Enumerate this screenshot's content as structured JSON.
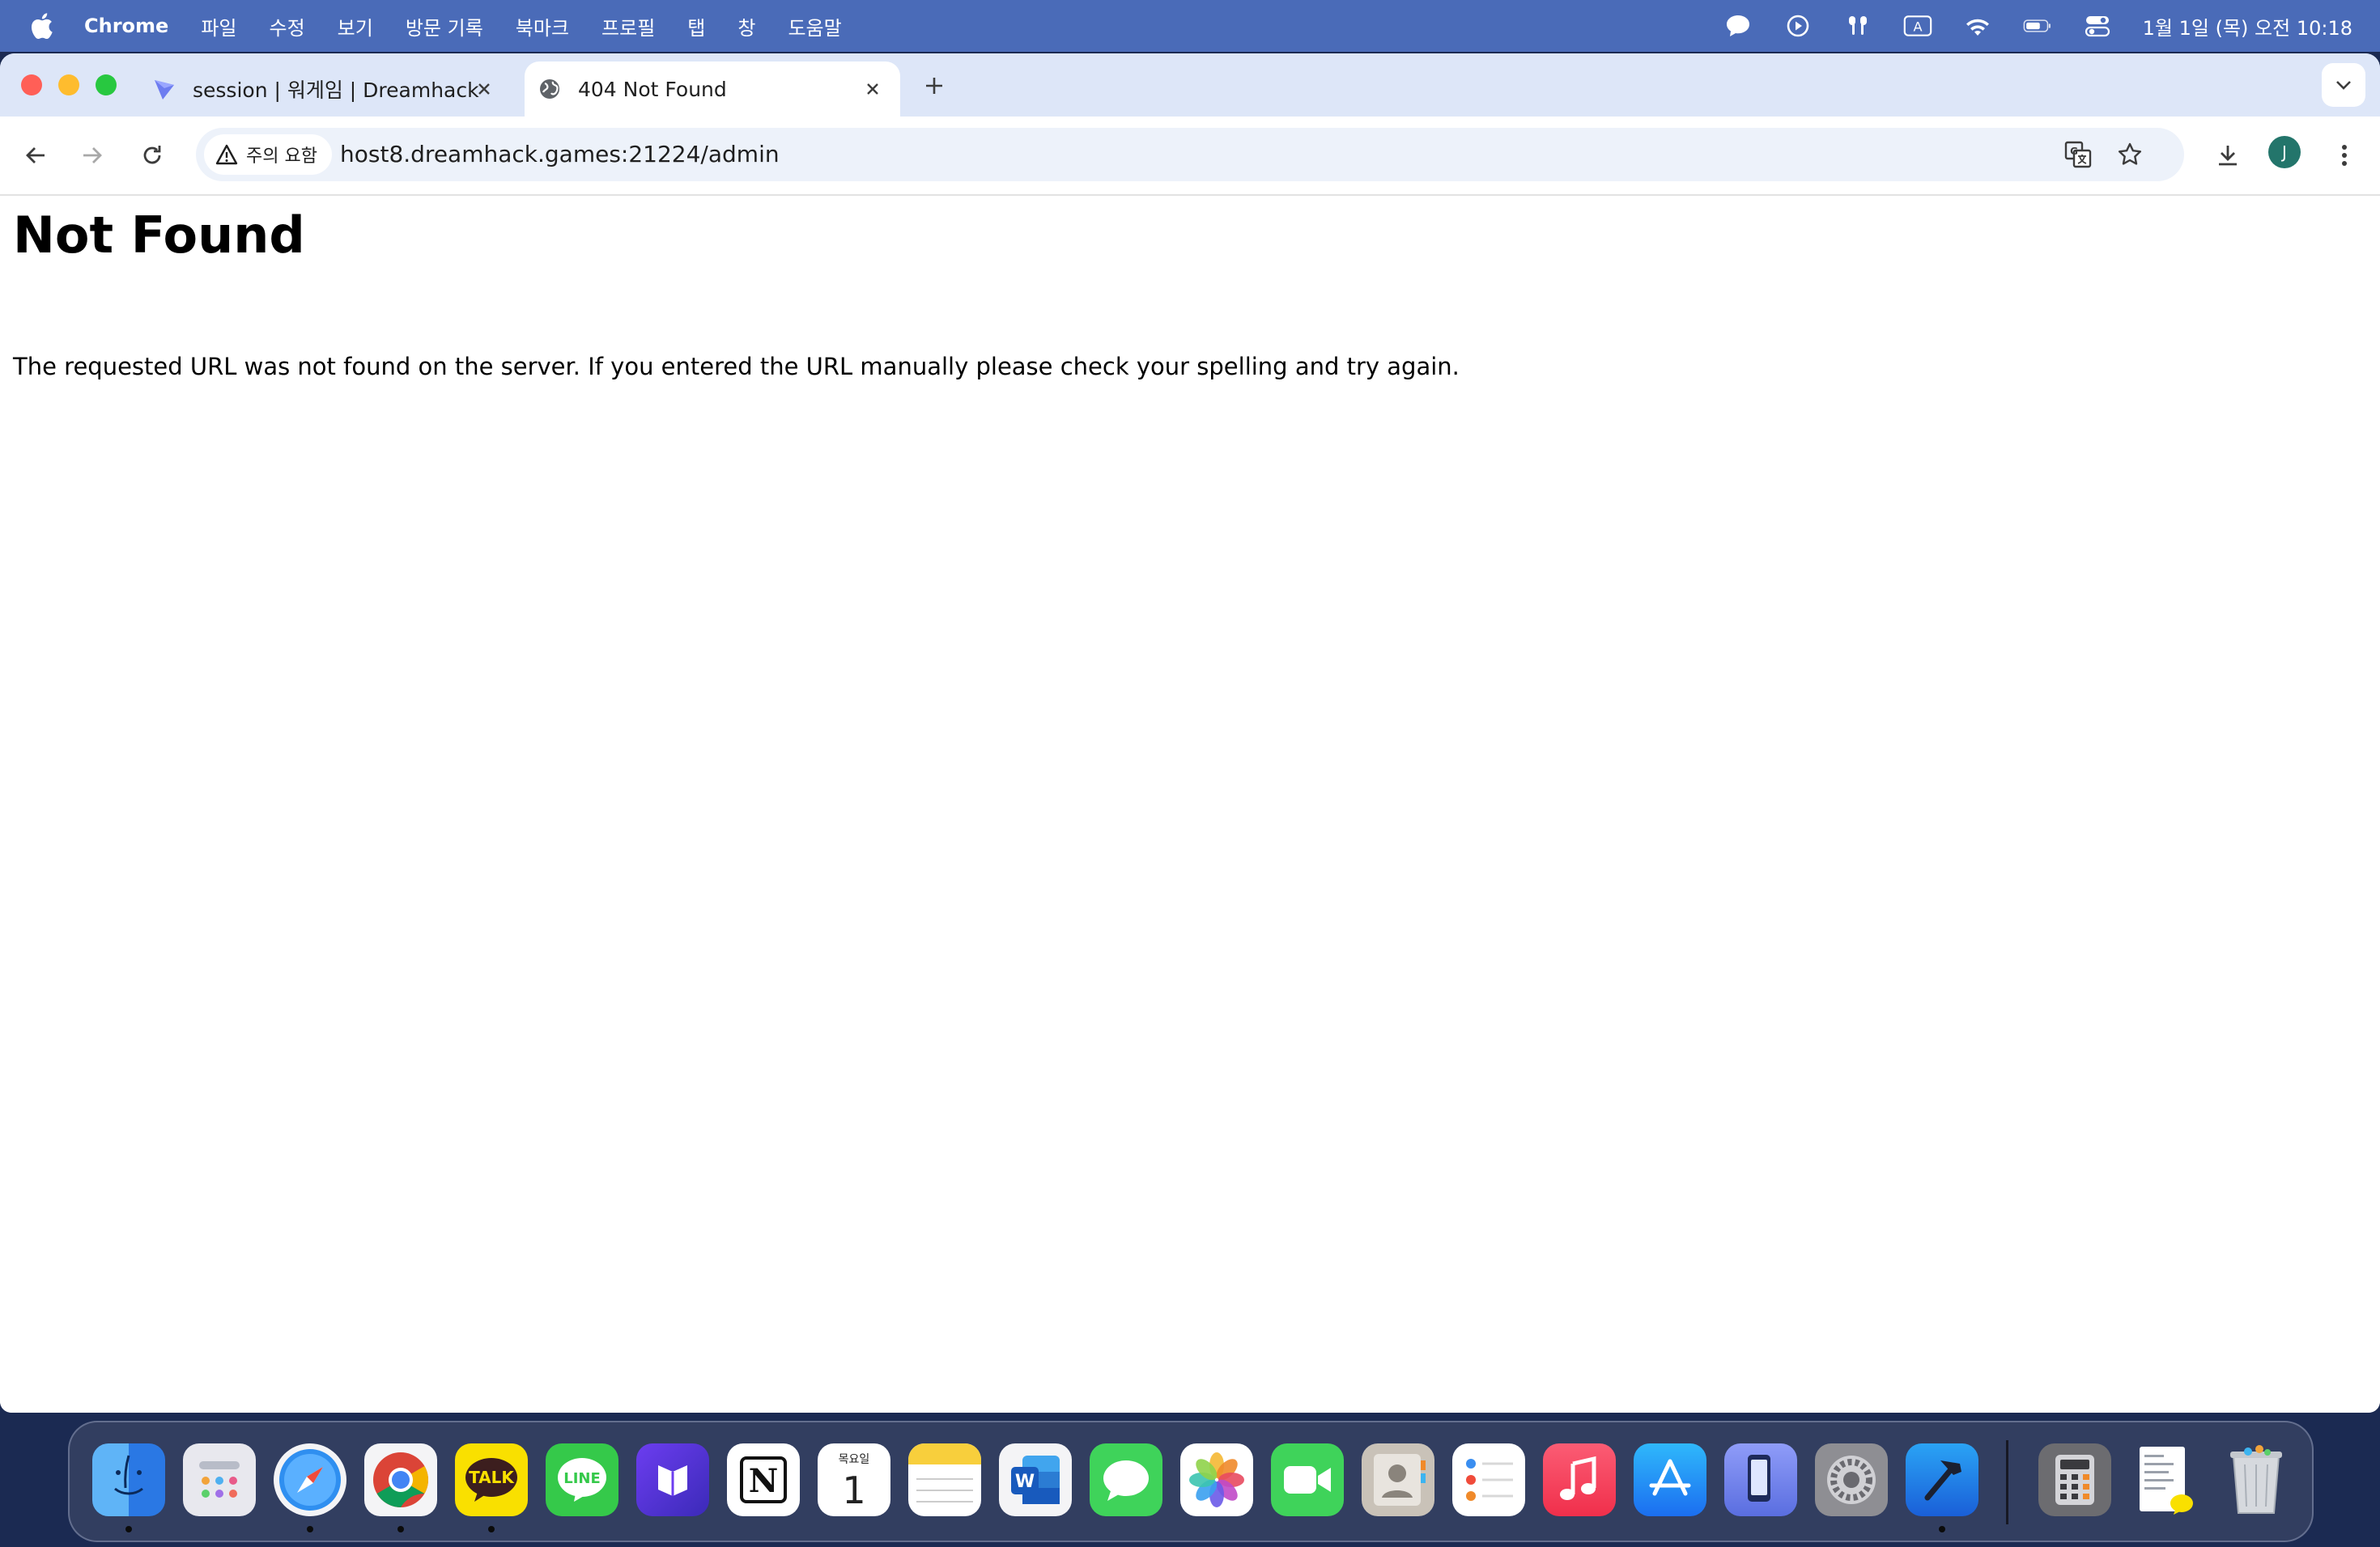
{
  "menubar": {
    "app_name": "Chrome",
    "menus": [
      "파일",
      "수정",
      "보기",
      "방문 기록",
      "북마크",
      "프로필",
      "탭",
      "창",
      "도움말"
    ],
    "clock": "1월 1일 (목) 오전 10:18",
    "status_icons": [
      "speech-bubble-icon",
      "play-circle-icon",
      "airpods-icon",
      "input-source-icon",
      "wifi-icon",
      "battery-icon",
      "control-center-icon"
    ],
    "input_source_letter": "A"
  },
  "tabs": [
    {
      "title": "session | 워게임 | Dreamhack",
      "favicon": "dreamhack-icon",
      "active": false
    },
    {
      "title": "404 Not Found",
      "favicon": "globe-icon",
      "active": true
    }
  ],
  "toolbar": {
    "security_chip": "주의 요함",
    "url": "host8.dreamhack.games:21224/admin",
    "profile_initial": "J"
  },
  "page": {
    "title": "Not Found",
    "message": "The requested URL was not found on the server. If you entered the URL manually please check your spelling and try again."
  },
  "dock": {
    "apps": [
      "Finder",
      "Launchpad",
      "Safari",
      "Chrome",
      "KakaoTalk",
      "LINE",
      "Mochi",
      "Notion",
      "Calendar",
      "Notes",
      "Word",
      "Messages",
      "Photos",
      "FaceTime",
      "Contacts",
      "Reminders",
      "Music",
      "App Store",
      "Simulator",
      "System Settings",
      "Xcode",
      "Calculator",
      "Preview",
      "Trash"
    ],
    "calendar_day": "1",
    "calendar_weekday": "목요일",
    "kakao_label": "TALK",
    "line_label": "LINE",
    "word_letter": "W",
    "notion_letter": "N"
  },
  "colors": {
    "menubar": "#4a6bb8",
    "tabstrip": "#dde6f8",
    "omnibox": "#edf2fa",
    "avatar": "#23756b",
    "traffic_red": "#ff5f57",
    "traffic_yellow": "#febc2e",
    "traffic_green": "#28c840"
  }
}
